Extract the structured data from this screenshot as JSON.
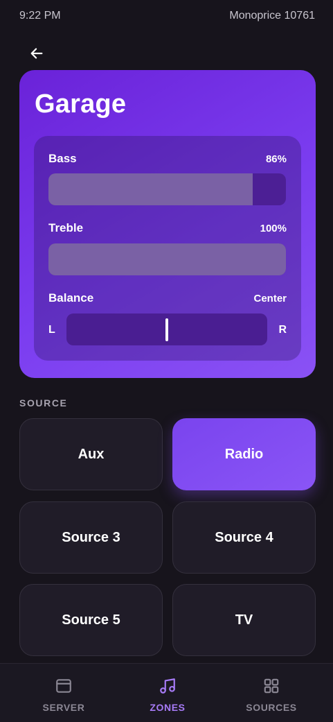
{
  "status_bar": {
    "time": "9:22 PM",
    "device": "Monoprice 10761"
  },
  "zone": {
    "name": "Garage",
    "bass": {
      "label": "Bass",
      "value_text": "86%",
      "level": 0.86
    },
    "treble": {
      "label": "Treble",
      "value_text": "100%",
      "level": 1.0
    },
    "balance": {
      "label": "Balance",
      "value_text": "Center",
      "left": "L",
      "right": "R",
      "position": 0.5
    }
  },
  "source_section": {
    "heading": "SOURCE",
    "sources": [
      {
        "label": "Aux",
        "active": false
      },
      {
        "label": "Radio",
        "active": true
      },
      {
        "label": "Source 3",
        "active": false
      },
      {
        "label": "Source 4",
        "active": false
      },
      {
        "label": "Source 5",
        "active": false
      },
      {
        "label": "TV",
        "active": false
      }
    ]
  },
  "bottom_nav": {
    "items": [
      {
        "label": "SERVER",
        "icon": "server-icon",
        "active": false
      },
      {
        "label": "ZONES",
        "icon": "music-note-icon",
        "active": true
      },
      {
        "label": "SOURCES",
        "icon": "grid-icon",
        "active": false
      }
    ]
  },
  "colors": {
    "accent": "#8a55f6",
    "background": "#17141c",
    "nav_active": "#a77bf7"
  }
}
